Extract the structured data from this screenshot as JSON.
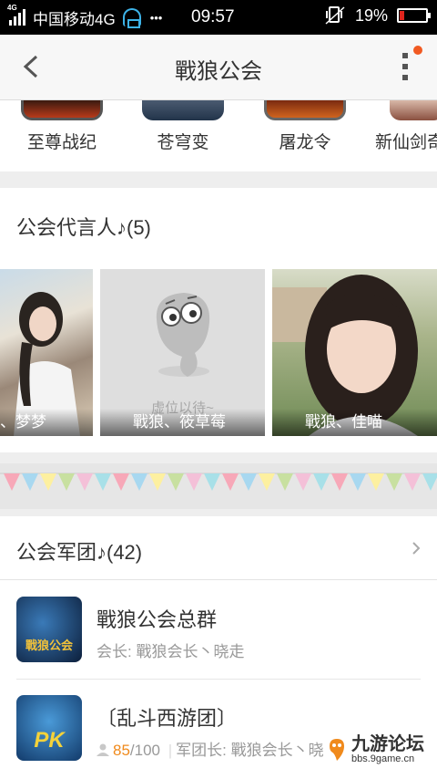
{
  "status_bar": {
    "network_type": "4G",
    "carrier": "中国移动4G",
    "more": "•••",
    "time": "09:57",
    "battery": "19%",
    "battery_level": 0.19
  },
  "header": {
    "title": "戰狼公会"
  },
  "games": [
    {
      "name": "至尊战纪"
    },
    {
      "name": "苍穹变"
    },
    {
      "name": "屠龙令"
    },
    {
      "name": "新仙剑奇"
    }
  ],
  "spokespersons": {
    "title": "公会代言人♪(5)",
    "cards": [
      {
        "caption": "、梦梦"
      },
      {
        "caption": "戰狼、筱草莓",
        "placeholder": "虚位以待~"
      },
      {
        "caption": "戰狼、佳喵"
      }
    ]
  },
  "legion": {
    "title": "公会军团♪(42)",
    "items": [
      {
        "name": "戰狼公会总群",
        "subtitle": "会长:  戰狼会长丶晓走",
        "avatar_text": "戰狼公会"
      },
      {
        "name": "〔乱斗西游团〕",
        "members": "85",
        "capacity": "/100",
        "leader": "军团长:  戰狼会长丶晓",
        "avatar_text": "PK"
      }
    ]
  },
  "watermark": {
    "text": "九游论坛",
    "url": "bbs.9game.cn"
  },
  "colors": {
    "accent_orange": "#f08a1c",
    "badge": "#f15a22",
    "battery_low": "#e0241c"
  }
}
